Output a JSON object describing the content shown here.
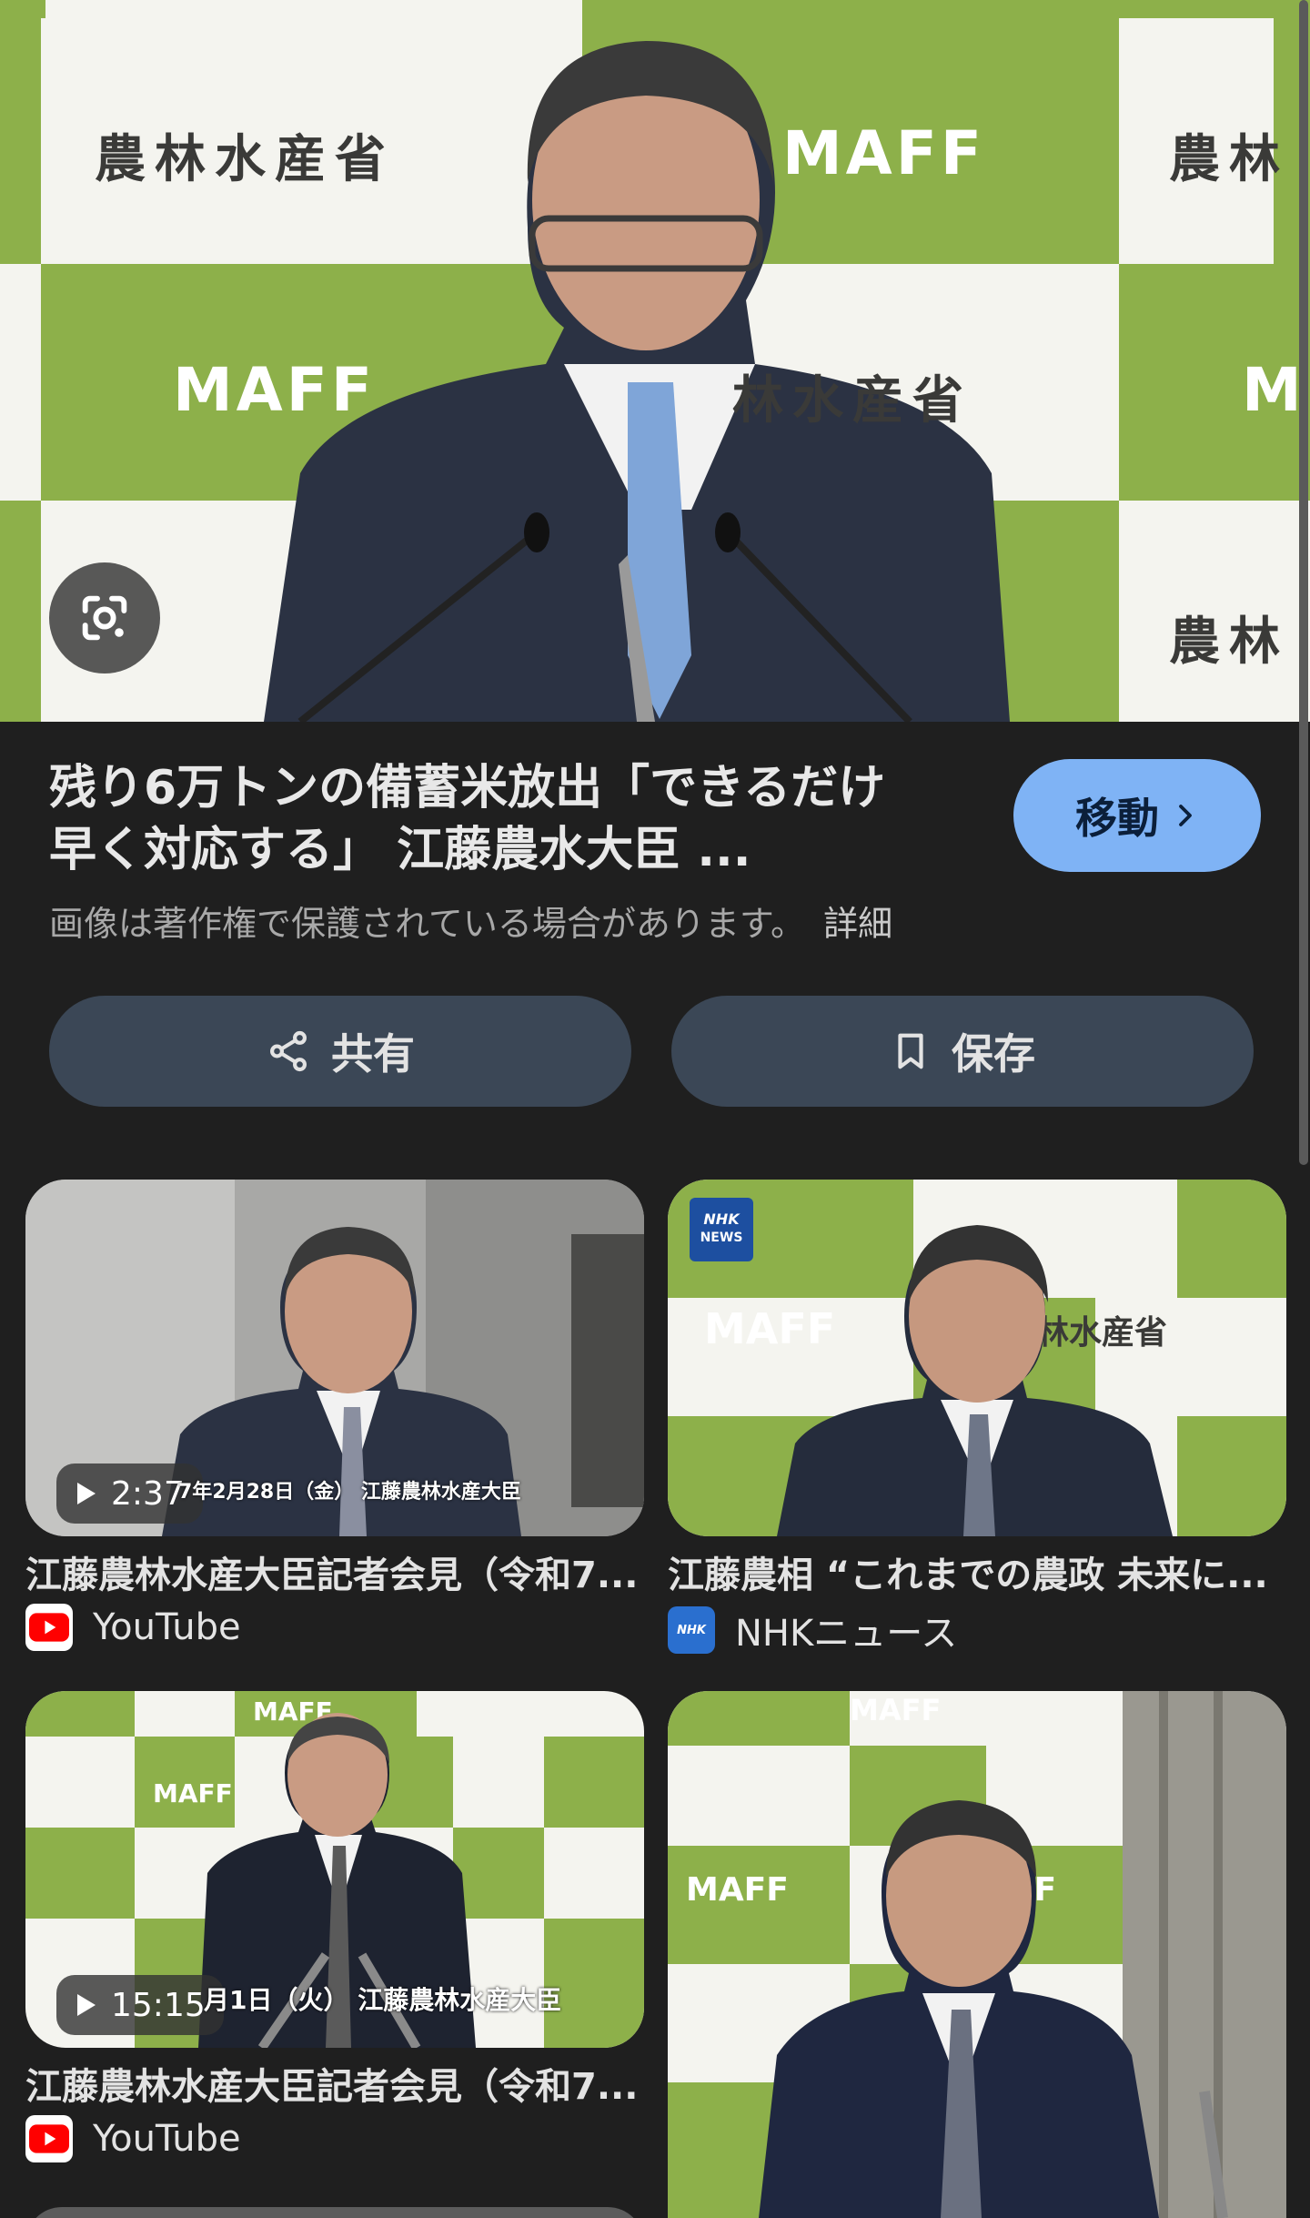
{
  "hero": {
    "backdrop_kanji": "農林水産省",
    "backdrop_kanji_partial": "農林",
    "backdrop_kanji_mid": "林水産省",
    "backdrop_maff": "MAFF",
    "backdrop_maff_partial": "M",
    "lens_icon": "lens-camera-icon"
  },
  "result": {
    "title_line1": "残り6万トンの備蓄米放出「できるだけ",
    "title_line2": "早く対応する」 江藤農水大臣 ...",
    "goto_label": "移動",
    "copyright_text": "画像は著作権で保護されている場合があります。",
    "details_label": "詳細",
    "share_label": "共有",
    "save_label": "保存"
  },
  "colors": {
    "background": "#1f1f1f",
    "accent_button": "#7fb3f5",
    "action_button": "#3b4756",
    "maff_green": "#8db04a",
    "youtube_red": "#ff0000",
    "nhk_blue": "#2a6fcf"
  },
  "cards": [
    {
      "title": "江藤農林水産大臣記者会見（令和7...",
      "source": "YouTube",
      "source_icon": "youtube-icon",
      "duration": "2:37",
      "overlay_caption": "7年2月28日（金） 江藤農林水産大臣"
    },
    {
      "title": "江藤農相 “これまでの農政 未来に...",
      "source": "NHKニュース",
      "source_icon": "nhk-icon",
      "badge_line1": "NHK",
      "badge_line2": "NEWS"
    },
    {
      "title": "江藤農林水産大臣記者会見（令和7...",
      "source": "YouTube",
      "source_icon": "youtube-icon",
      "duration": "15:15",
      "overlay_caption": "月1日（火） 江藤農林水産大臣"
    },
    {
      "title": "",
      "source": ""
    }
  ]
}
